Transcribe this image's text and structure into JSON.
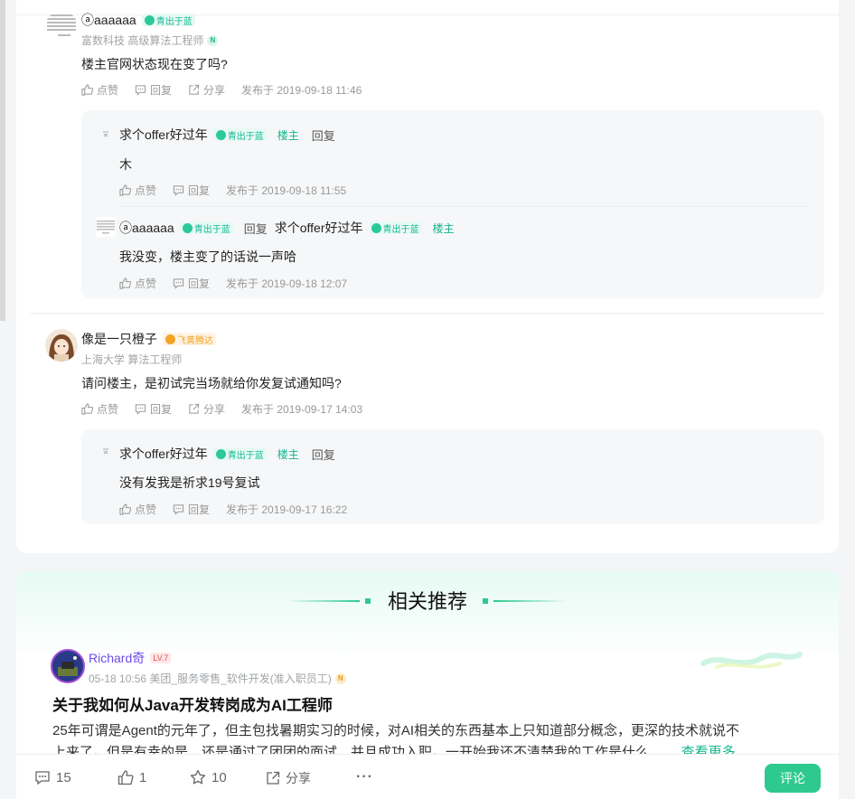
{
  "comments": [
    {
      "user": "ⓐaaaaaa",
      "badge": "青出于蓝",
      "meta": "富数科技  高级算法工程师",
      "text": "楼主官网状态现在变了吗?",
      "actions": {
        "like": "点赞",
        "reply": "回复",
        "share": "分享"
      },
      "date": "发布于 2019-09-18 11:46",
      "replies": [
        {
          "user": "求个offer好过年",
          "badge": "青出于蓝",
          "host": "楼主",
          "reply_label": "回复",
          "text": "木",
          "actions": {
            "like": "点赞",
            "reply": "回复"
          },
          "date": "发布于 2019-09-18 11:55"
        },
        {
          "user": "ⓐaaaaaa",
          "badge": "青出于蓝",
          "reply_label": "回复",
          "target_user": "求个offer好过年",
          "target_badge": "青出于蓝",
          "target_host": "楼主",
          "text": "我没变，楼主变了的话说一声哈",
          "actions": {
            "like": "点赞",
            "reply": "回复"
          },
          "date": "发布于 2019-09-18 12:07"
        }
      ]
    },
    {
      "user": "像是一只橙子",
      "badge": "飞黄腾达",
      "meta": "上海大学 算法工程师",
      "text": "请问楼主，是初试完当场就给你发复试通知吗?",
      "actions": {
        "like": "点赞",
        "reply": "回复",
        "share": "分享"
      },
      "date": "发布于 2019-09-17 14:03",
      "replies": [
        {
          "user": "求个offer好过年",
          "badge": "青出于蓝",
          "host": "楼主",
          "reply_label": "回复",
          "text": "没有发我是祈求19号复试",
          "actions": {
            "like": "点赞",
            "reply": "回复"
          },
          "date": "发布于 2019-09-17 16:22"
        }
      ]
    }
  ],
  "recommend": {
    "title": "相关推荐",
    "post": {
      "user": "Richard奇",
      "level": "LV.7",
      "meta": "05-18 10:56  美团_服务零售_软件开发(准入职员工)",
      "title": "关于我如何从Java开发转岗成为AI工程师",
      "excerpt_line1": "25年可谓是Agent的元年了，但主包找暑期实习的时候，对AI相关的东西基本上只知道部分概念，更深的技术就说不",
      "excerpt_line2": "上来了。但是有幸的是，还是通过了团团的面试，并且成功入职。一开始我还不清楚我的工作是什么，",
      "more": "... 查看更多"
    }
  },
  "bottom_bar": {
    "comments": "15",
    "likes": "1",
    "stars": "10",
    "share": "分享",
    "more": "···",
    "comment_button": "评论"
  },
  "colors": {
    "accent": "#2ec98e",
    "host": "#12b48c",
    "badge_orange": "#f3a423"
  }
}
